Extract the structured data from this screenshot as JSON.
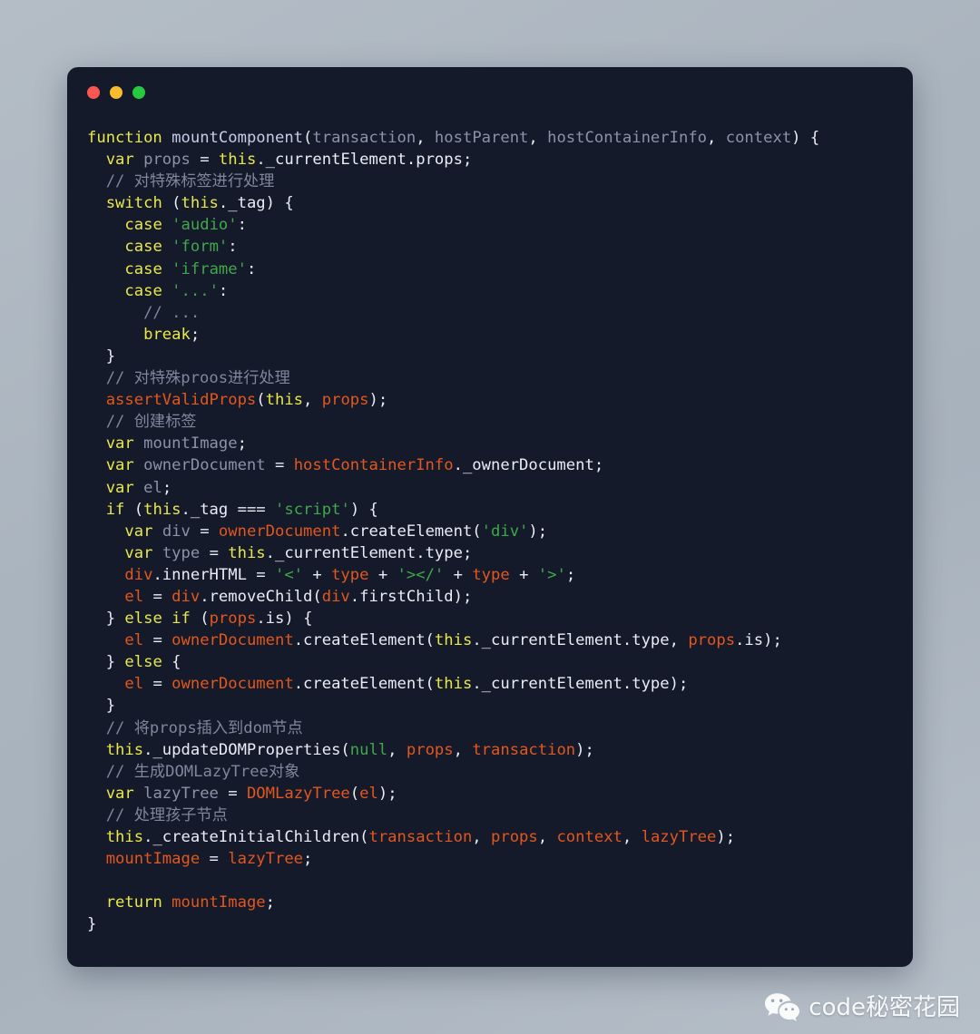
{
  "window": {
    "controls": [
      {
        "name": "close",
        "color": "#f9574f",
        "label": "Close"
      },
      {
        "name": "minimize",
        "color": "#fcbb2b",
        "label": "Minimize"
      },
      {
        "name": "zoom",
        "color": "#27c93f",
        "label": "Zoom"
      }
    ],
    "background": "#151a2a"
  },
  "theme": {
    "page_background": "#aab4be",
    "keyword": "#e8e84a",
    "function_name": "#c6cce6",
    "parameter": "#8b93a8",
    "identifier": "#e2571e",
    "string": "#3fa84a",
    "comment": "#7e879c",
    "text": "#e9edf5"
  },
  "code": {
    "language": "javascript",
    "plain_text": "function mountComponent(transaction, hostParent, hostContainerInfo, context) {\n  var props = this._currentElement.props;\n  // 对特殊标签进行处理\n  switch (this._tag) {\n    case 'audio':\n    case 'form':\n    case 'iframe':\n    case '...':\n      // ...\n      break;\n  }\n  // 对特殊proos进行处理\n  assertValidProps(this, props);\n  // 创建标签\n  var mountImage;\n  var ownerDocument = hostContainerInfo._ownerDocument;\n  var el;\n  if (this._tag === 'script') {\n    var div = ownerDocument.createElement('div');\n    var type = this._currentElement.type;\n    div.innerHTML = '<' + type + '></' + type + '>';\n    el = div.removeChild(div.firstChild);\n  } else if (props.is) {\n    el = ownerDocument.createElement(this._currentElement.type, props.is);\n  } else {\n    el = ownerDocument.createElement(this._currentElement.type);\n  }\n  // 将props插入到dom节点\n  this._updateDOMProperties(null, props, transaction);\n  // 生成DOMLazyTree对象\n  var lazyTree = DOMLazyTree(el);\n  // 处理孩子节点\n  this._createInitialChildren(transaction, props, context, lazyTree);\n  mountImage = lazyTree;\n\n  return mountImage;\n}",
    "lines": [
      [
        {
          "t": "function",
          "c": "kw"
        },
        {
          "t": " ",
          "c": "punc"
        },
        {
          "t": "mountComponent",
          "c": "fn"
        },
        {
          "t": "(",
          "c": "punc"
        },
        {
          "t": "transaction",
          "c": "par"
        },
        {
          "t": ", ",
          "c": "punc"
        },
        {
          "t": "hostParent",
          "c": "par"
        },
        {
          "t": ", ",
          "c": "punc"
        },
        {
          "t": "hostContainerInfo",
          "c": "par"
        },
        {
          "t": ", ",
          "c": "punc"
        },
        {
          "t": "context",
          "c": "par"
        },
        {
          "t": ") {",
          "c": "punc"
        }
      ],
      [
        {
          "t": "  ",
          "c": "punc"
        },
        {
          "t": "var",
          "c": "kw"
        },
        {
          "t": " ",
          "c": "punc"
        },
        {
          "t": "props",
          "c": "par"
        },
        {
          "t": " = ",
          "c": "punc"
        },
        {
          "t": "this",
          "c": "kw"
        },
        {
          "t": "._currentElement.props;",
          "c": "prop"
        }
      ],
      [
        {
          "t": "  // 对特殊标签进行处理",
          "c": "cmt"
        }
      ],
      [
        {
          "t": "  ",
          "c": "punc"
        },
        {
          "t": "switch",
          "c": "kw"
        },
        {
          "t": " (",
          "c": "punc"
        },
        {
          "t": "this",
          "c": "kw"
        },
        {
          "t": "._tag",
          "c": "prop"
        },
        {
          "t": ") {",
          "c": "punc"
        }
      ],
      [
        {
          "t": "    ",
          "c": "punc"
        },
        {
          "t": "case",
          "c": "kw"
        },
        {
          "t": " ",
          "c": "punc"
        },
        {
          "t": "'audio'",
          "c": "str"
        },
        {
          "t": ":",
          "c": "punc"
        }
      ],
      [
        {
          "t": "    ",
          "c": "punc"
        },
        {
          "t": "case",
          "c": "kw"
        },
        {
          "t": " ",
          "c": "punc"
        },
        {
          "t": "'form'",
          "c": "str"
        },
        {
          "t": ":",
          "c": "punc"
        }
      ],
      [
        {
          "t": "    ",
          "c": "punc"
        },
        {
          "t": "case",
          "c": "kw"
        },
        {
          "t": " ",
          "c": "punc"
        },
        {
          "t": "'iframe'",
          "c": "str"
        },
        {
          "t": ":",
          "c": "punc"
        }
      ],
      [
        {
          "t": "    ",
          "c": "punc"
        },
        {
          "t": "case",
          "c": "kw"
        },
        {
          "t": " ",
          "c": "punc"
        },
        {
          "t": "'...'",
          "c": "str"
        },
        {
          "t": ":",
          "c": "punc"
        }
      ],
      [
        {
          "t": "      // ...",
          "c": "cmt"
        }
      ],
      [
        {
          "t": "      ",
          "c": "punc"
        },
        {
          "t": "break",
          "c": "kw"
        },
        {
          "t": ";",
          "c": "punc"
        }
      ],
      [
        {
          "t": "  }",
          "c": "punc"
        }
      ],
      [
        {
          "t": "  // 对特殊proos进行处理",
          "c": "cmt"
        }
      ],
      [
        {
          "t": "  ",
          "c": "punc"
        },
        {
          "t": "assertValidProps",
          "c": "id"
        },
        {
          "t": "(",
          "c": "punc"
        },
        {
          "t": "this",
          "c": "kw"
        },
        {
          "t": ", ",
          "c": "punc"
        },
        {
          "t": "props",
          "c": "id"
        },
        {
          "t": ");",
          "c": "punc"
        }
      ],
      [
        {
          "t": "  // 创建标签",
          "c": "cmt"
        }
      ],
      [
        {
          "t": "  ",
          "c": "punc"
        },
        {
          "t": "var",
          "c": "kw"
        },
        {
          "t": " ",
          "c": "punc"
        },
        {
          "t": "mountImage",
          "c": "par"
        },
        {
          "t": ";",
          "c": "punc"
        }
      ],
      [
        {
          "t": "  ",
          "c": "punc"
        },
        {
          "t": "var",
          "c": "kw"
        },
        {
          "t": " ",
          "c": "punc"
        },
        {
          "t": "ownerDocument",
          "c": "par"
        },
        {
          "t": " = ",
          "c": "punc"
        },
        {
          "t": "hostContainerInfo",
          "c": "id"
        },
        {
          "t": "._ownerDocument;",
          "c": "prop"
        }
      ],
      [
        {
          "t": "  ",
          "c": "punc"
        },
        {
          "t": "var",
          "c": "kw"
        },
        {
          "t": " ",
          "c": "punc"
        },
        {
          "t": "el",
          "c": "par"
        },
        {
          "t": ";",
          "c": "punc"
        }
      ],
      [
        {
          "t": "  ",
          "c": "punc"
        },
        {
          "t": "if",
          "c": "kw"
        },
        {
          "t": " (",
          "c": "punc"
        },
        {
          "t": "this",
          "c": "kw"
        },
        {
          "t": "._tag",
          "c": "prop"
        },
        {
          "t": " === ",
          "c": "punc"
        },
        {
          "t": "'script'",
          "c": "str"
        },
        {
          "t": ") {",
          "c": "punc"
        }
      ],
      [
        {
          "t": "    ",
          "c": "punc"
        },
        {
          "t": "var",
          "c": "kw"
        },
        {
          "t": " ",
          "c": "punc"
        },
        {
          "t": "div",
          "c": "par"
        },
        {
          "t": " = ",
          "c": "punc"
        },
        {
          "t": "ownerDocument",
          "c": "id"
        },
        {
          "t": ".createElement(",
          "c": "prop"
        },
        {
          "t": "'div'",
          "c": "str"
        },
        {
          "t": ");",
          "c": "punc"
        }
      ],
      [
        {
          "t": "    ",
          "c": "punc"
        },
        {
          "t": "var",
          "c": "kw"
        },
        {
          "t": " ",
          "c": "punc"
        },
        {
          "t": "type",
          "c": "par"
        },
        {
          "t": " = ",
          "c": "punc"
        },
        {
          "t": "this",
          "c": "kw"
        },
        {
          "t": "._currentElement.type;",
          "c": "prop"
        }
      ],
      [
        {
          "t": "    ",
          "c": "punc"
        },
        {
          "t": "div",
          "c": "id"
        },
        {
          "t": ".innerHTML = ",
          "c": "prop"
        },
        {
          "t": "'<'",
          "c": "str"
        },
        {
          "t": " + ",
          "c": "punc"
        },
        {
          "t": "type",
          "c": "id"
        },
        {
          "t": " + ",
          "c": "punc"
        },
        {
          "t": "'></'",
          "c": "str"
        },
        {
          "t": " + ",
          "c": "punc"
        },
        {
          "t": "type",
          "c": "id"
        },
        {
          "t": " + ",
          "c": "punc"
        },
        {
          "t": "'>'",
          "c": "str"
        },
        {
          "t": ";",
          "c": "punc"
        }
      ],
      [
        {
          "t": "    ",
          "c": "punc"
        },
        {
          "t": "el",
          "c": "id"
        },
        {
          "t": " = ",
          "c": "punc"
        },
        {
          "t": "div",
          "c": "id"
        },
        {
          "t": ".removeChild(",
          "c": "prop"
        },
        {
          "t": "div",
          "c": "id"
        },
        {
          "t": ".firstChild);",
          "c": "prop"
        }
      ],
      [
        {
          "t": "  } ",
          "c": "punc"
        },
        {
          "t": "else",
          "c": "kw"
        },
        {
          "t": " ",
          "c": "punc"
        },
        {
          "t": "if",
          "c": "kw"
        },
        {
          "t": " (",
          "c": "punc"
        },
        {
          "t": "props",
          "c": "id"
        },
        {
          "t": ".is",
          "c": "prop"
        },
        {
          "t": ") {",
          "c": "punc"
        }
      ],
      [
        {
          "t": "    ",
          "c": "punc"
        },
        {
          "t": "el",
          "c": "id"
        },
        {
          "t": " = ",
          "c": "punc"
        },
        {
          "t": "ownerDocument",
          "c": "id"
        },
        {
          "t": ".createElement(",
          "c": "prop"
        },
        {
          "t": "this",
          "c": "kw"
        },
        {
          "t": "._currentElement.type",
          "c": "prop"
        },
        {
          "t": ", ",
          "c": "punc"
        },
        {
          "t": "props",
          "c": "id"
        },
        {
          "t": ".is);",
          "c": "prop"
        }
      ],
      [
        {
          "t": "  } ",
          "c": "punc"
        },
        {
          "t": "else",
          "c": "kw"
        },
        {
          "t": " {",
          "c": "punc"
        }
      ],
      [
        {
          "t": "    ",
          "c": "punc"
        },
        {
          "t": "el",
          "c": "id"
        },
        {
          "t": " = ",
          "c": "punc"
        },
        {
          "t": "ownerDocument",
          "c": "id"
        },
        {
          "t": ".createElement(",
          "c": "prop"
        },
        {
          "t": "this",
          "c": "kw"
        },
        {
          "t": "._currentElement.type);",
          "c": "prop"
        }
      ],
      [
        {
          "t": "  }",
          "c": "punc"
        }
      ],
      [
        {
          "t": "  // 将props插入到dom节点",
          "c": "cmt"
        }
      ],
      [
        {
          "t": "  ",
          "c": "punc"
        },
        {
          "t": "this",
          "c": "kw"
        },
        {
          "t": "._updateDOMProperties(",
          "c": "prop"
        },
        {
          "t": "null",
          "c": "cn"
        },
        {
          "t": ", ",
          "c": "punc"
        },
        {
          "t": "props",
          "c": "id"
        },
        {
          "t": ", ",
          "c": "punc"
        },
        {
          "t": "transaction",
          "c": "id"
        },
        {
          "t": ");",
          "c": "punc"
        }
      ],
      [
        {
          "t": "  // 生成DOMLazyTree对象",
          "c": "cmt"
        }
      ],
      [
        {
          "t": "  ",
          "c": "punc"
        },
        {
          "t": "var",
          "c": "kw"
        },
        {
          "t": " ",
          "c": "punc"
        },
        {
          "t": "lazyTree",
          "c": "par"
        },
        {
          "t": " = ",
          "c": "punc"
        },
        {
          "t": "DOMLazyTree",
          "c": "id"
        },
        {
          "t": "(",
          "c": "punc"
        },
        {
          "t": "el",
          "c": "id"
        },
        {
          "t": ");",
          "c": "punc"
        }
      ],
      [
        {
          "t": "  // 处理孩子节点",
          "c": "cmt"
        }
      ],
      [
        {
          "t": "  ",
          "c": "punc"
        },
        {
          "t": "this",
          "c": "kw"
        },
        {
          "t": "._createInitialChildren(",
          "c": "prop"
        },
        {
          "t": "transaction",
          "c": "id"
        },
        {
          "t": ", ",
          "c": "punc"
        },
        {
          "t": "props",
          "c": "id"
        },
        {
          "t": ", ",
          "c": "punc"
        },
        {
          "t": "context",
          "c": "id"
        },
        {
          "t": ", ",
          "c": "punc"
        },
        {
          "t": "lazyTree",
          "c": "id"
        },
        {
          "t": ");",
          "c": "punc"
        }
      ],
      [
        {
          "t": "  ",
          "c": "punc"
        },
        {
          "t": "mountImage",
          "c": "id"
        },
        {
          "t": " = ",
          "c": "punc"
        },
        {
          "t": "lazyTree",
          "c": "id"
        },
        {
          "t": ";",
          "c": "punc"
        }
      ],
      [],
      [
        {
          "t": "  ",
          "c": "punc"
        },
        {
          "t": "return",
          "c": "kw"
        },
        {
          "t": " ",
          "c": "punc"
        },
        {
          "t": "mountImage",
          "c": "id"
        },
        {
          "t": ";",
          "c": "punc"
        }
      ],
      [
        {
          "t": "}",
          "c": "punc"
        }
      ]
    ]
  },
  "watermark": {
    "text": "code秘密花园",
    "icon": "wechat-icon"
  }
}
